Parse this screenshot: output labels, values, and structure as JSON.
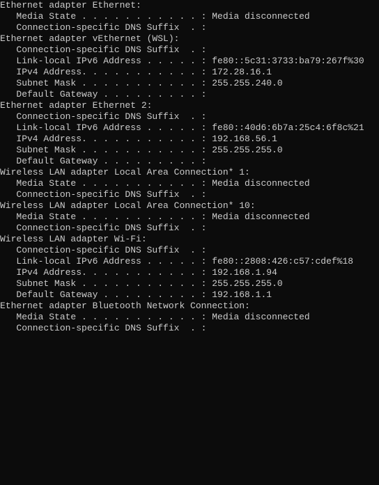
{
  "adapters": [
    {
      "header": "Ethernet adapter Ethernet:",
      "rows": [
        {
          "label": "   Media State . . . . . . . . . . . : ",
          "value": "Media disconnected"
        },
        {
          "label": "   Connection-specific DNS Suffix  . :",
          "value": ""
        }
      ]
    },
    {
      "header": "Ethernet adapter vEthernet (WSL):",
      "rows": [
        {
          "label": "   Connection-specific DNS Suffix  . :",
          "value": ""
        },
        {
          "label": "   Link-local IPv6 Address . . . . . : ",
          "value": "fe80::5c31:3733:ba79:267f%30"
        },
        {
          "label": "   IPv4 Address. . . . . . . . . . . : ",
          "value": "172.28.16.1"
        },
        {
          "label": "   Subnet Mask . . . . . . . . . . . : ",
          "value": "255.255.240.0"
        },
        {
          "label": "   Default Gateway . . . . . . . . . :",
          "value": ""
        }
      ]
    },
    {
      "header": "Ethernet adapter Ethernet 2:",
      "rows": [
        {
          "label": "   Connection-specific DNS Suffix  . :",
          "value": ""
        },
        {
          "label": "   Link-local IPv6 Address . . . . . : ",
          "value": "fe80::40d6:6b7a:25c4:6f8c%21"
        },
        {
          "label": "   IPv4 Address. . . . . . . . . . . : ",
          "value": "192.168.56.1"
        },
        {
          "label": "   Subnet Mask . . . . . . . . . . . : ",
          "value": "255.255.255.0"
        },
        {
          "label": "   Default Gateway . . . . . . . . . :",
          "value": ""
        }
      ]
    },
    {
      "header": "Wireless LAN adapter Local Area Connection* 1:",
      "rows": [
        {
          "label": "   Media State . . . . . . . . . . . : ",
          "value": "Media disconnected"
        },
        {
          "label": "   Connection-specific DNS Suffix  . :",
          "value": ""
        }
      ]
    },
    {
      "header": "Wireless LAN adapter Local Area Connection* 10:",
      "rows": [
        {
          "label": "   Media State . . . . . . . . . . . : ",
          "value": "Media disconnected"
        },
        {
          "label": "   Connection-specific DNS Suffix  . :",
          "value": ""
        }
      ]
    },
    {
      "header": "Wireless LAN adapter Wi-Fi:",
      "rows": [
        {
          "label": "   Connection-specific DNS Suffix  . :",
          "value": ""
        },
        {
          "label": "   Link-local IPv6 Address . . . . . : ",
          "value": "fe80::2808:426:c57:cdef%18"
        },
        {
          "label": "   IPv4 Address. . . . . . . . . . . : ",
          "value": "192.168.1.94"
        },
        {
          "label": "   Subnet Mask . . . . . . . . . . . : ",
          "value": "255.255.255.0"
        },
        {
          "label": "   Default Gateway . . . . . . . . . : ",
          "value": "192.168.1.1",
          "highlight": true
        }
      ]
    },
    {
      "header": "Ethernet adapter Bluetooth Network Connection:",
      "rows": [
        {
          "label": "   Media State . . . . . . . . . . . : ",
          "value": "Media disconnected"
        },
        {
          "label": "   Connection-specific DNS Suffix  . :",
          "value": ""
        }
      ]
    }
  ]
}
